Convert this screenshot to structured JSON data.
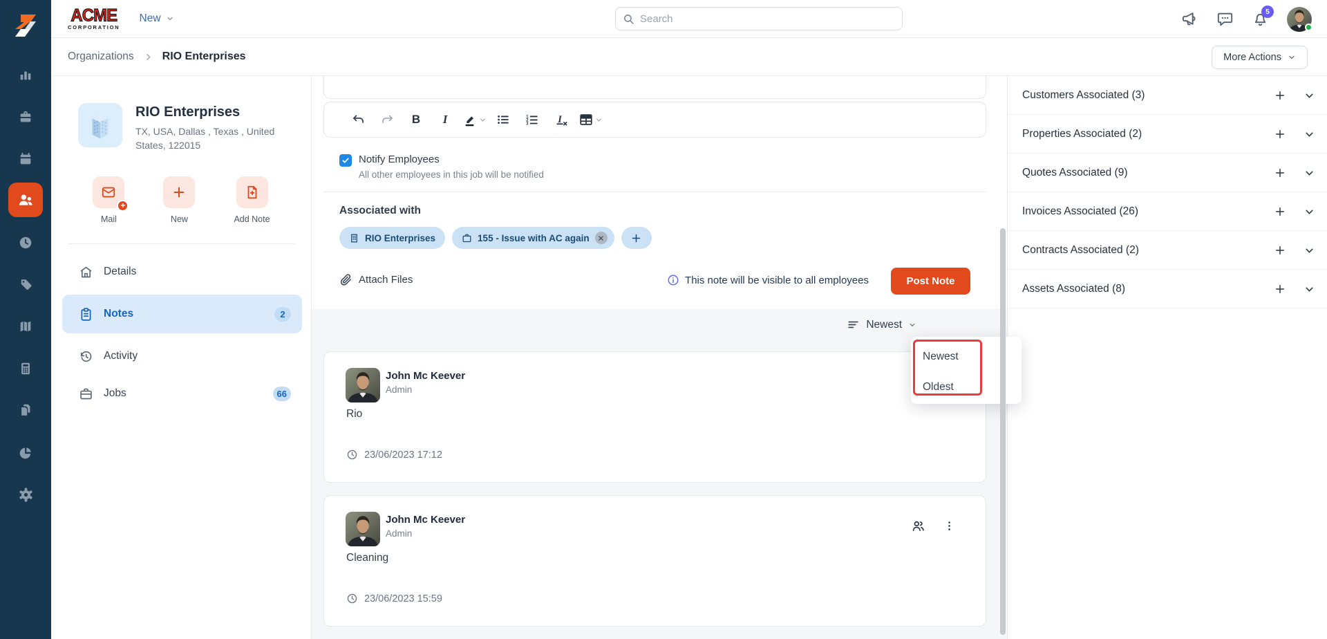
{
  "topbar": {
    "logo_line1": "ACME",
    "logo_line2": "CORPORATION",
    "new_label": "New",
    "search_placeholder": "Search",
    "notification_count": "5"
  },
  "breadcrumb": {
    "parent": "Organizations",
    "current": "RIO Enterprises",
    "more_actions_label": "More Actions"
  },
  "rail": {
    "icons": [
      "bar-chart",
      "briefcase",
      "calendar",
      "users",
      "clock",
      "tag",
      "map",
      "calculator",
      "copy-pages",
      "pie-chart",
      "gear"
    ],
    "active_icon": "users"
  },
  "org_panel": {
    "name": "RIO Enterprises",
    "address": "TX, USA, Dallas , Texas , United States, 122015",
    "actions": [
      {
        "label": "Mail"
      },
      {
        "label": "New"
      },
      {
        "label": "Add Note"
      }
    ],
    "nav": [
      {
        "label": "Details"
      },
      {
        "label": "Notes",
        "badge": "2"
      },
      {
        "label": "Activity"
      },
      {
        "label": "Jobs",
        "badge": "66"
      }
    ]
  },
  "composer": {
    "notify_label": "Notify Employees",
    "notify_description": "All other employees in this job will be notified",
    "associated_heading": "Associated with",
    "chips": [
      {
        "label": "RIO Enterprises"
      },
      {
        "label": "155 - Issue with AC again"
      }
    ],
    "attach_label": "Attach Files",
    "visibility_note": "This note will be visible to all employees",
    "post_button_label": "Post Note"
  },
  "notes": {
    "sort_label": "Newest",
    "sort_options": [
      "Newest",
      "Oldest"
    ],
    "items": [
      {
        "author": "John Mc Keever",
        "role": "Admin",
        "body": "Rio",
        "timestamp": "23/06/2023 17:12"
      },
      {
        "author": "John Mc Keever",
        "role": "Admin",
        "body": "Cleaning",
        "timestamp": "23/06/2023 15:59"
      }
    ]
  },
  "right_sidebar": {
    "sections": [
      {
        "label": "Customers Associated (3)"
      },
      {
        "label": "Properties Associated (2)"
      },
      {
        "label": "Quotes Associated (9)"
      },
      {
        "label": "Invoices Associated (26)"
      },
      {
        "label": "Contracts Associated (2)"
      },
      {
        "label": "Assets Associated (8)"
      }
    ]
  },
  "colors": {
    "rail_navy": "#16374E",
    "accent_orange": "#E2491C",
    "active_nav_blue": "#1565C0",
    "chip_blue_bg": "#CBE2F6",
    "chip_blue_text": "#1B4B72",
    "checkbox_blue": "#1E88E5",
    "notification_purple": "#6A5BF7",
    "annotation_red": "#E53E3E",
    "status_green": "#22B14C"
  }
}
